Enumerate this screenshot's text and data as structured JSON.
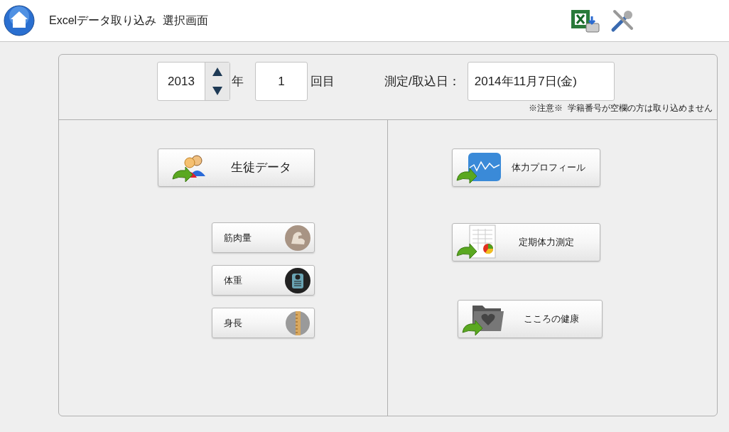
{
  "header": {
    "title": "Excelデータ取り込み  選択画面"
  },
  "controls": {
    "year": "2013",
    "year_unit": "年",
    "round": "1",
    "round_unit": "回目",
    "date_label": "測定/取込日：",
    "date": "2014年11月7日(金)",
    "note": "※注意※  学籍番号が空欄の方は取り込めません"
  },
  "student_button": {
    "label": "生徒データ",
    "kind": "students"
  },
  "left_buttons": [
    {
      "label": "筋肉量",
      "kind": "muscle"
    },
    {
      "label": "体重",
      "kind": "scale"
    },
    {
      "label": "身長",
      "kind": "ruler"
    }
  ],
  "right_buttons": [
    {
      "label": "体力プロフィール",
      "kind": "graph"
    },
    {
      "label": "定期体力測定",
      "kind": "sheet"
    },
    {
      "label": "こころの健康",
      "kind": "folder"
    }
  ]
}
